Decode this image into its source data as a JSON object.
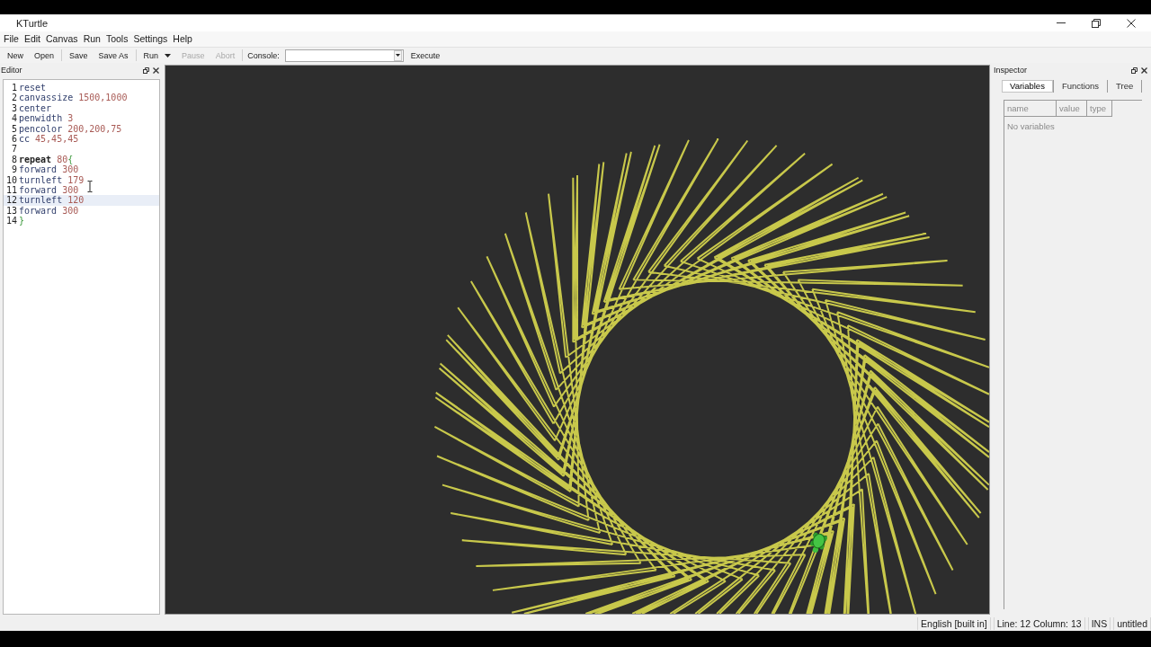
{
  "window": {
    "title": "KTurtle"
  },
  "menu_bar": [
    "File",
    "Edit",
    "Canvas",
    "Run",
    "Tools",
    "Settings",
    "Help"
  ],
  "toolbar": [
    {
      "kind": "button",
      "label": "New",
      "disabled": false
    },
    {
      "kind": "button",
      "label": "Open",
      "disabled": false
    },
    {
      "kind": "separator"
    },
    {
      "kind": "button",
      "label": "Save",
      "disabled": false
    },
    {
      "kind": "button",
      "label": "Save As",
      "disabled": false
    },
    {
      "kind": "separator"
    },
    {
      "kind": "menu-button",
      "label": "Run",
      "disabled": false
    },
    {
      "kind": "button",
      "label": "Pause",
      "disabled": true
    },
    {
      "kind": "button",
      "label": "Abort",
      "disabled": true
    },
    {
      "kind": "separator"
    },
    {
      "kind": "combo",
      "label": "Console:"
    },
    {
      "kind": "button",
      "label": "Execute",
      "disabled": false
    }
  ],
  "editor": {
    "title": "Editor",
    "lines": [
      {
        "number": "1",
        "current": false,
        "tokens": [
          {
            "kind": "command",
            "text": "reset"
          }
        ]
      },
      {
        "number": "2",
        "current": false,
        "tokens": [
          {
            "kind": "command",
            "text": "canvassize "
          },
          {
            "kind": "number",
            "text": "1500,1000"
          }
        ]
      },
      {
        "number": "3",
        "current": false,
        "tokens": [
          {
            "kind": "command",
            "text": "center"
          }
        ]
      },
      {
        "number": "4",
        "current": false,
        "tokens": [
          {
            "kind": "command",
            "text": "penwidth "
          },
          {
            "kind": "number",
            "text": "3"
          }
        ]
      },
      {
        "number": "5",
        "current": false,
        "tokens": [
          {
            "kind": "command",
            "text": "pencolor "
          },
          {
            "kind": "number",
            "text": "200,200,75"
          }
        ]
      },
      {
        "number": "6",
        "current": false,
        "tokens": [
          {
            "kind": "command",
            "text": "cc "
          },
          {
            "kind": "number",
            "text": "45,45,45"
          }
        ]
      },
      {
        "number": "7",
        "current": false
      },
      {
        "number": "8",
        "current": false,
        "tokens": [
          {
            "kind": "keyword",
            "text": "repeat "
          },
          {
            "kind": "number",
            "text": "80"
          },
          {
            "kind": "bracket",
            "text": "{"
          }
        ]
      },
      {
        "number": "9",
        "current": false,
        "tokens": [
          {
            "kind": "command",
            "text": "forward "
          },
          {
            "kind": "number",
            "text": "300"
          }
        ]
      },
      {
        "number": "10",
        "current": false,
        "tokens": [
          {
            "kind": "command",
            "text": "turnleft "
          },
          {
            "kind": "number",
            "text": "179"
          }
        ]
      },
      {
        "number": "11",
        "current": false,
        "tokens": [
          {
            "kind": "command",
            "text": "forward "
          },
          {
            "kind": "number",
            "text": "300"
          }
        ]
      },
      {
        "number": "12",
        "current": true,
        "tokens": [
          {
            "kind": "command",
            "text": "turnleft "
          },
          {
            "kind": "number",
            "text": "120"
          }
        ]
      },
      {
        "number": "13",
        "current": false,
        "tokens": [
          {
            "kind": "command",
            "text": "forward "
          },
          {
            "kind": "number",
            "text": "300"
          }
        ]
      },
      {
        "number": "14",
        "current": false,
        "tokens": [
          {
            "kind": "bracket",
            "text": "}"
          }
        ]
      }
    ]
  },
  "inspector": {
    "title": "Inspector",
    "tabs": [
      {
        "label": "Variables",
        "selected": true
      },
      {
        "label": "Functions",
        "selected": false
      },
      {
        "label": "Tree",
        "selected": false
      }
    ],
    "columns": [
      "name",
      "value",
      "type"
    ],
    "empty_text": "No variables"
  },
  "status_bar": [
    "English [built in]",
    "Line: 12 Column: 13",
    "INS",
    "untitled"
  ]
}
